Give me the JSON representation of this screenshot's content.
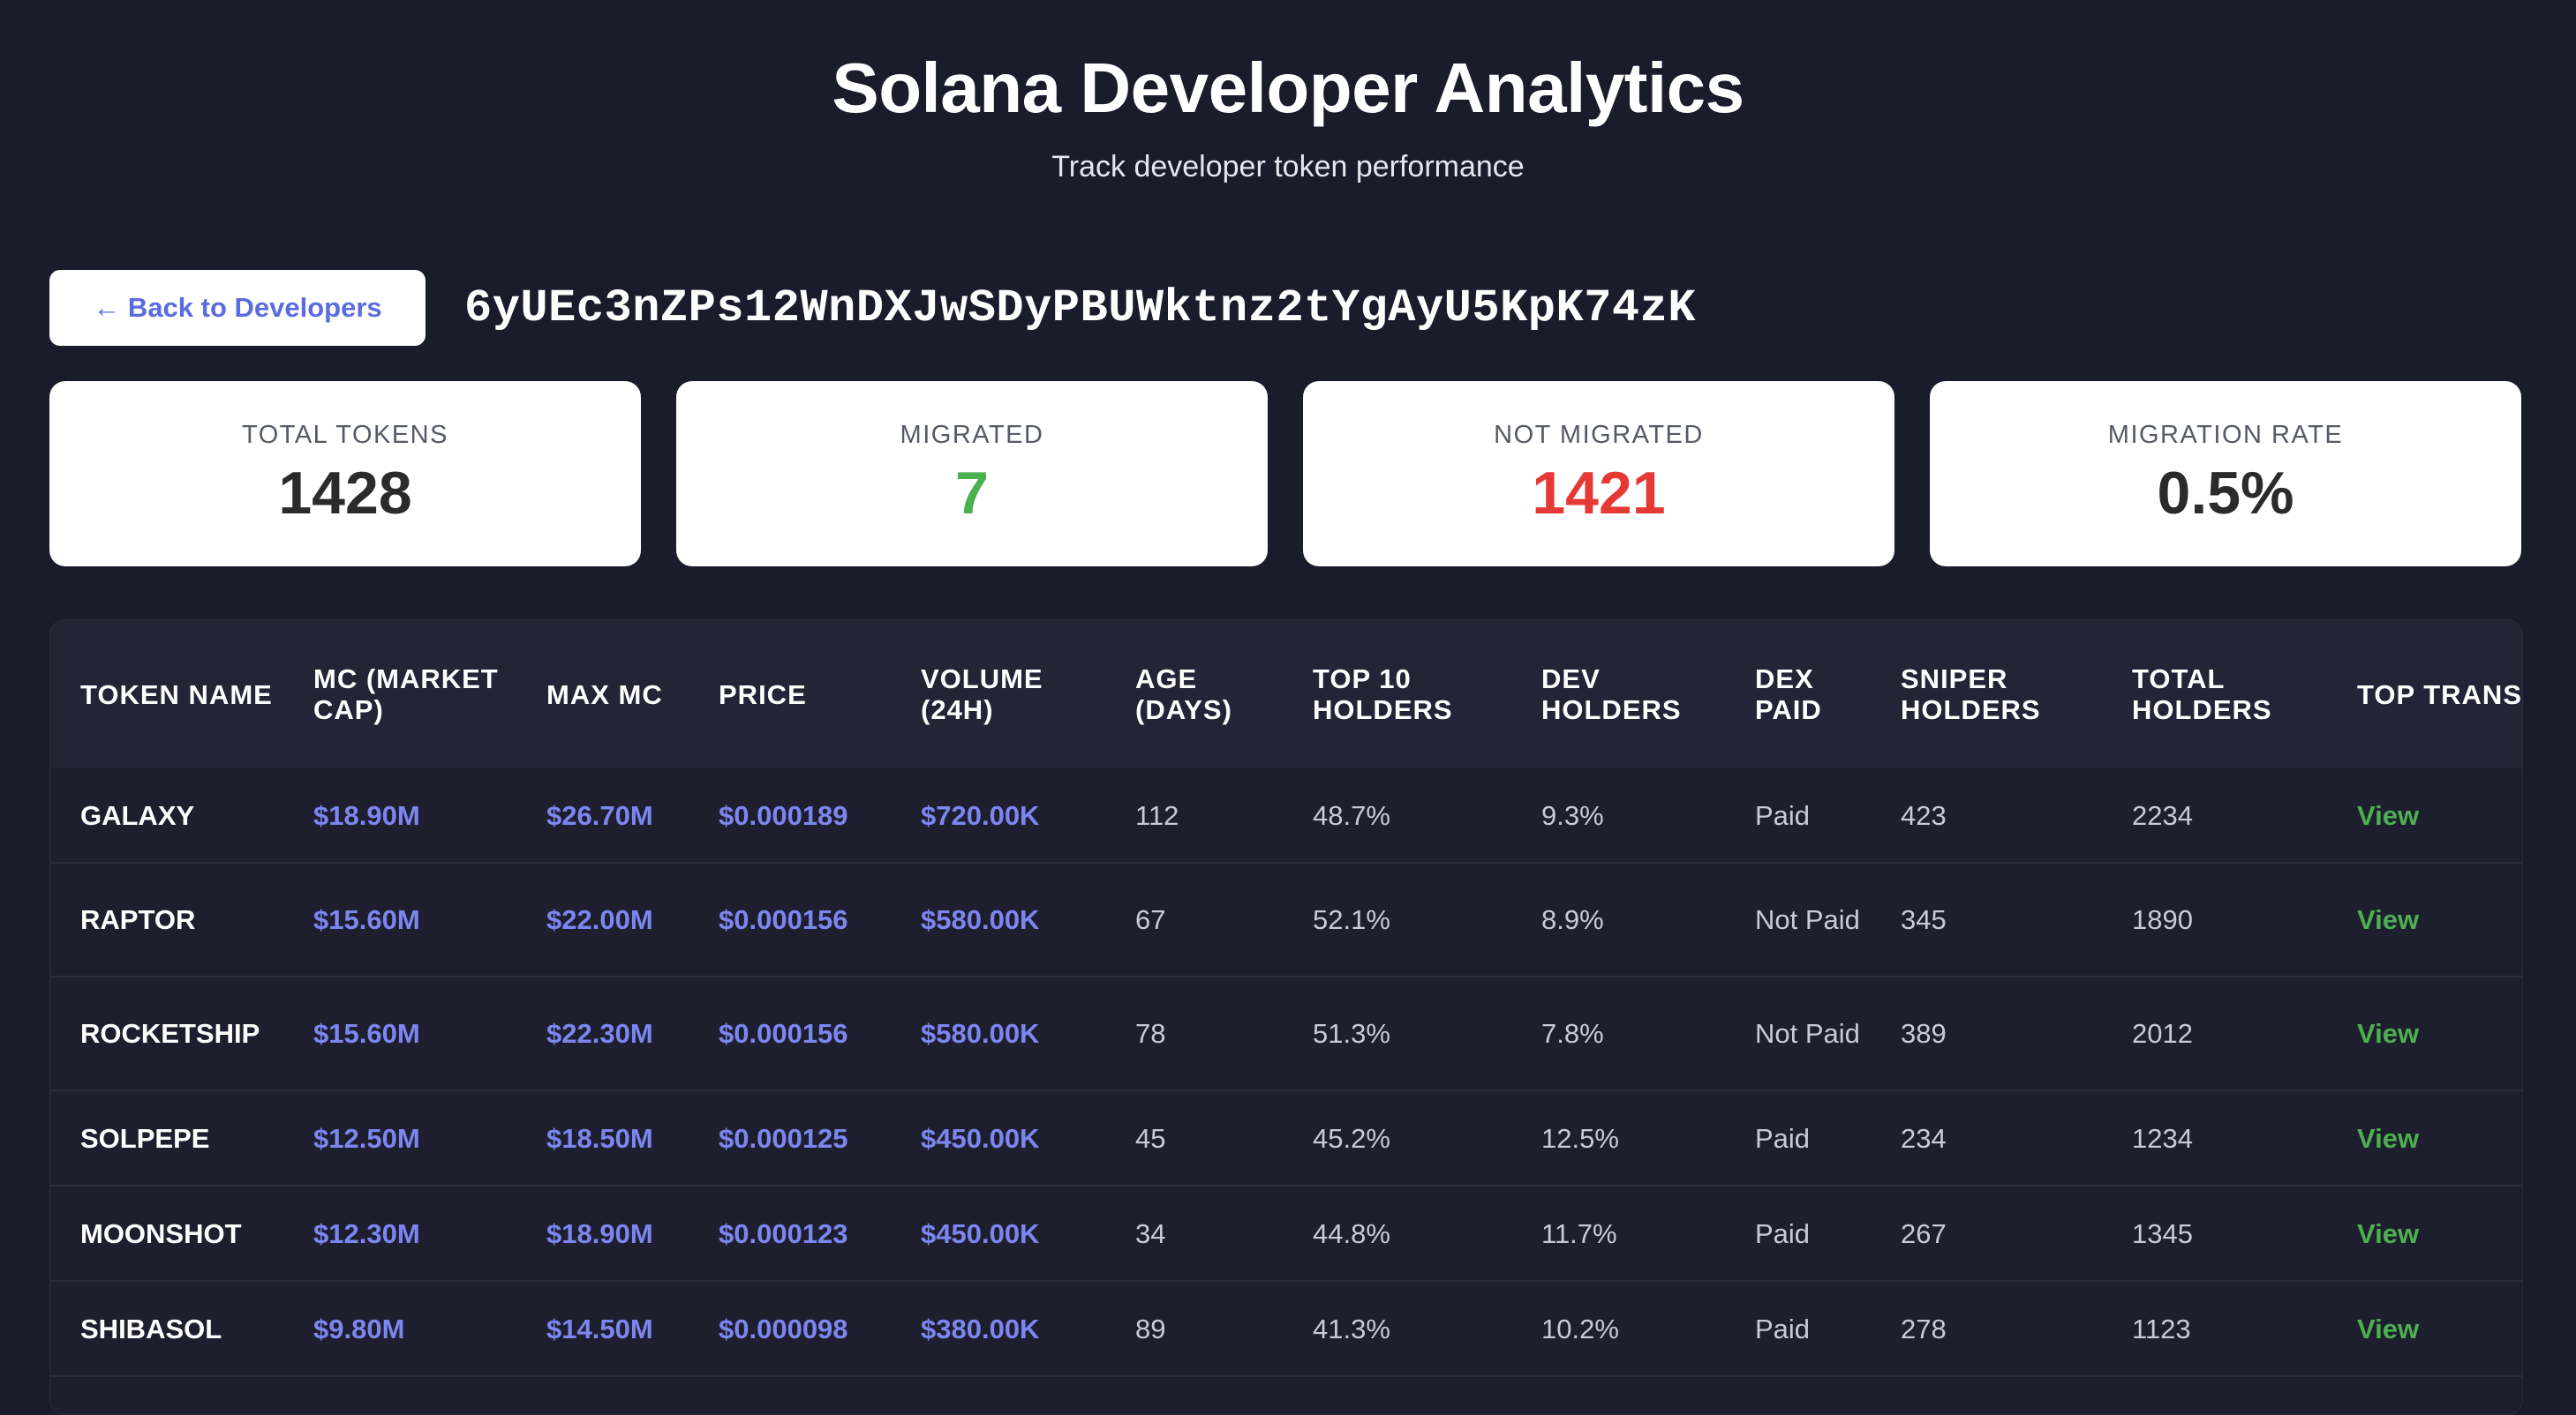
{
  "header": {
    "title": "Solana Developer Analytics",
    "subtitle": "Track developer token performance"
  },
  "toolbar": {
    "back_label": "← Back to Developers",
    "address": "6yUEc3nZPs12WnDXJwSDyPBUWktnz2tYgAyU5KpK74zK"
  },
  "stats": [
    {
      "label": "TOTAL TOKENS",
      "value": "1428"
    },
    {
      "label": "MIGRATED",
      "value": "7",
      "color": "#4caf50"
    },
    {
      "label": "NOT MIGRATED",
      "value": "1421",
      "color": "#e53935"
    },
    {
      "label": "MIGRATION RATE",
      "value": "0.5%"
    }
  ],
  "table": {
    "columns": [
      "Token Name",
      "MC (Market Cap)",
      "Max MC",
      "Price",
      "Volume (24h)",
      "Age (Days)",
      "Top 10 Holders",
      "Dev Holders",
      "DEX Paid",
      "Sniper Holders",
      "Total Holders",
      "Top Transacti"
    ],
    "rows": [
      {
        "name": "GALAXY",
        "mc": "$18.90M",
        "max_mc": "$26.70M",
        "price": "$0.000189",
        "volume": "$720.00K",
        "age": "112",
        "top10": "48.7%",
        "dev": "9.3%",
        "dex": "Paid",
        "sniper": "423",
        "total": "2234",
        "action": "View"
      },
      {
        "name": "RAPTOR",
        "mc": "$15.60M",
        "max_mc": "$22.00M",
        "price": "$0.000156",
        "volume": "$580.00K",
        "age": "67",
        "top10": "52.1%",
        "dev": "8.9%",
        "dex": "Not Paid",
        "sniper": "345",
        "total": "1890",
        "action": "View"
      },
      {
        "name": "ROCKETSHIP",
        "mc": "$15.60M",
        "max_mc": "$22.30M",
        "price": "$0.000156",
        "volume": "$580.00K",
        "age": "78",
        "top10": "51.3%",
        "dev": "7.8%",
        "dex": "Not Paid",
        "sniper": "389",
        "total": "2012",
        "action": "View"
      },
      {
        "name": "SOLPEPE",
        "mc": "$12.50M",
        "max_mc": "$18.50M",
        "price": "$0.000125",
        "volume": "$450.00K",
        "age": "45",
        "top10": "45.2%",
        "dev": "12.5%",
        "dex": "Paid",
        "sniper": "234",
        "total": "1234",
        "action": "View"
      },
      {
        "name": "MOONSHOT",
        "mc": "$12.30M",
        "max_mc": "$18.90M",
        "price": "$0.000123",
        "volume": "$450.00K",
        "age": "34",
        "top10": "44.8%",
        "dev": "11.7%",
        "dex": "Paid",
        "sniper": "267",
        "total": "1345",
        "action": "View"
      },
      {
        "name": "SHIBASOL",
        "mc": "$9.80M",
        "max_mc": "$14.50M",
        "price": "$0.000098",
        "volume": "$380.00K",
        "age": "89",
        "top10": "41.3%",
        "dev": "10.2%",
        "dex": "Paid",
        "sniper": "278",
        "total": "1123",
        "action": "View"
      }
    ]
  }
}
